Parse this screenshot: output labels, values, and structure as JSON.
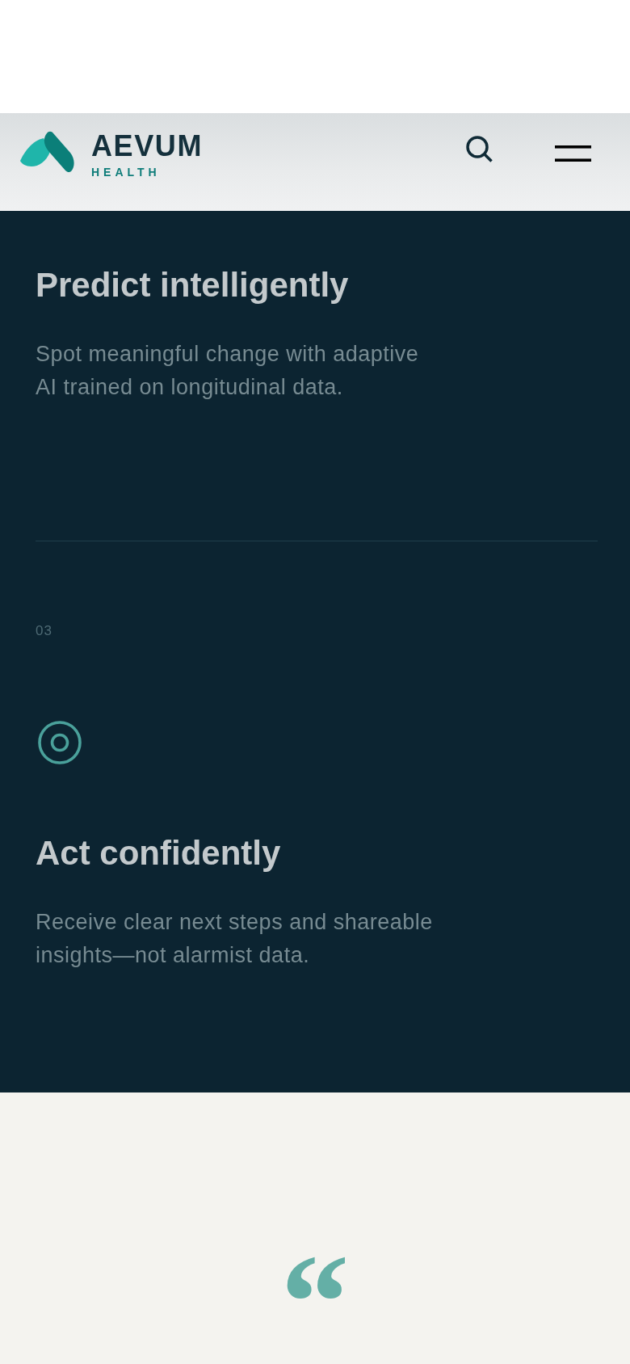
{
  "header": {
    "logo": {
      "name": "AEVUM",
      "tagline": "HEALTH"
    }
  },
  "features": [
    {
      "kind": "continued",
      "title": "Predict intelligently",
      "description": "Spot meaningful change with adaptive\nAI trained on longitudinal data."
    },
    {
      "kind": "full",
      "number": "03",
      "title": "Act confidently",
      "description": "Receive clear next steps and shareable\ninsights—not alarmist data."
    }
  ],
  "testimonial": {
    "quote_mark": "“"
  }
}
